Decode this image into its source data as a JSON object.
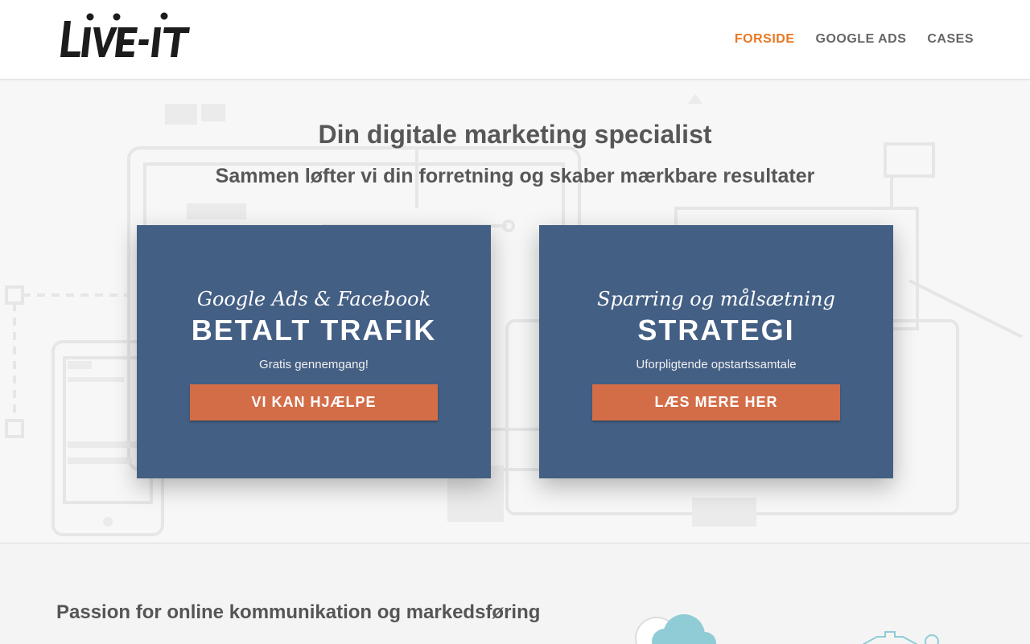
{
  "header": {
    "logo_text": "LIVE-IT",
    "nav": [
      {
        "label": "FORSIDE",
        "active": true
      },
      {
        "label": "GOOGLE ADS",
        "active": false
      },
      {
        "label": "CASES",
        "active": false
      }
    ]
  },
  "hero": {
    "title": "Din digitale marketing specialist",
    "subtitle": "Sammen løfter vi din forretning og skaber mærkbare resultater",
    "cards": [
      {
        "script": "Google Ads & Facebook",
        "title": "BETALT TRAFIK",
        "text": "Gratis gennemgang!",
        "button": "VI KAN HJÆLPE"
      },
      {
        "script": "Sparring og målsætning",
        "title": "STRATEGI",
        "text": "Uforpligtende opstartssamtale",
        "button": "LÆS MERE HER"
      }
    ]
  },
  "section2": {
    "heading": "Passion for online kommunikation og markedsføring"
  },
  "colors": {
    "accent_nav": "#e87722",
    "card_bg": "#445f84",
    "button_bg": "#d36d48",
    "text_dark": "#575757"
  }
}
